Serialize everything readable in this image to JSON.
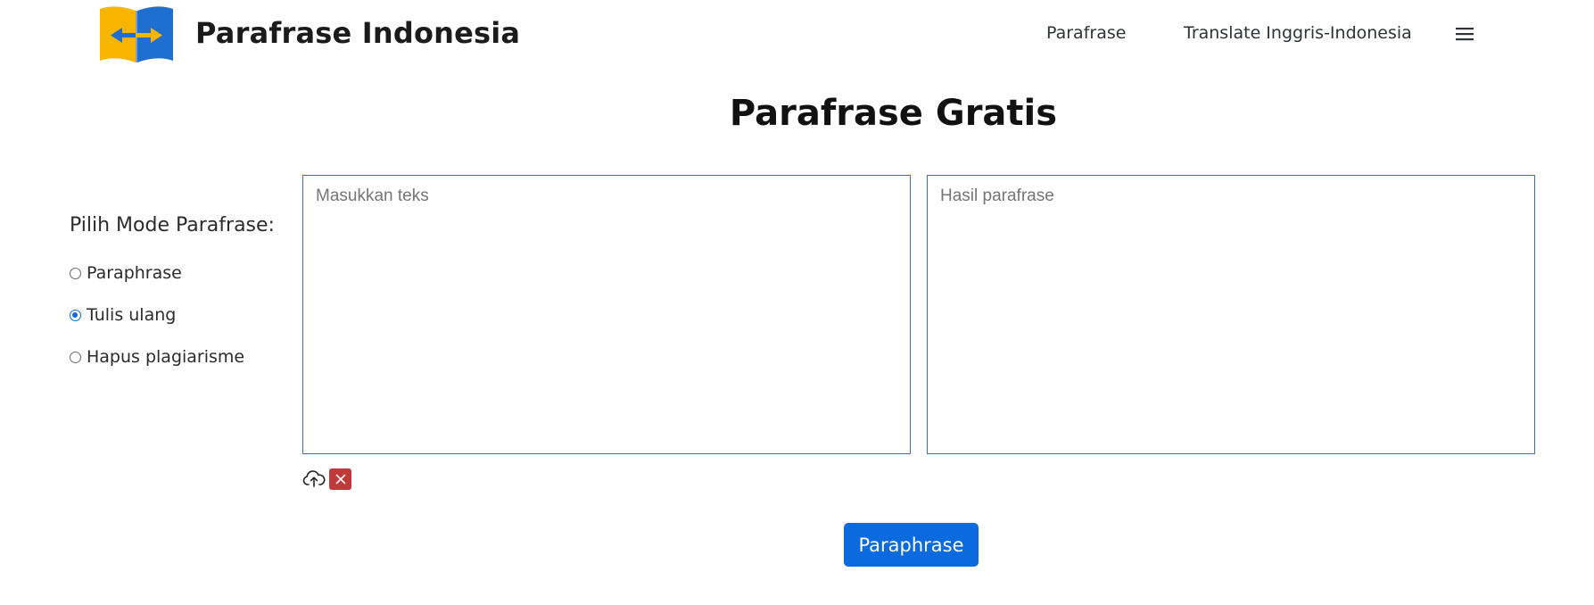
{
  "header": {
    "brand": "Parafrase Indonesia",
    "logo_icon": "book-arrows-logo-icon",
    "nav": [
      {
        "label": "Parafrase"
      },
      {
        "label": "Translate Inggris-Indonesia"
      }
    ],
    "menu_icon": "hamburger-menu-icon"
  },
  "main": {
    "title": "Parafrase Gratis",
    "mode": {
      "heading": "Pilih Mode Parafrase:",
      "options": [
        {
          "label": "Paraphrase",
          "checked": false
        },
        {
          "label": "Tulis ulang",
          "checked": true
        },
        {
          "label": "Hapus plagiarisme",
          "checked": false
        }
      ]
    },
    "input": {
      "value": "",
      "placeholder": "Masukkan teks"
    },
    "output": {
      "value": "",
      "placeholder": "Hasil parafrase"
    },
    "tools": {
      "upload_icon": "cloud-upload-icon",
      "clear_icon": "close-icon"
    },
    "submit_label": "Paraphrase"
  },
  "colors": {
    "primary": "#0a6ade",
    "danger": "#c0393b",
    "textarea_border": "#3a6fb4",
    "logo_yellow": "#f7b500",
    "logo_blue": "#1f6fd1"
  }
}
